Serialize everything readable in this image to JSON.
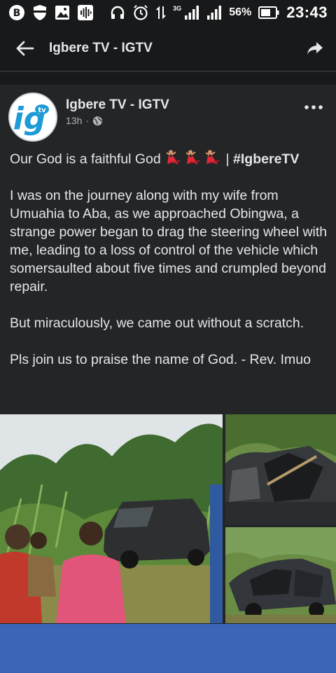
{
  "status_bar": {
    "network": "3G",
    "battery_percent": "56%",
    "time": "23:43"
  },
  "app_bar": {
    "title": "Igbere TV - IGTV"
  },
  "post": {
    "author": "Igbere TV - IGTV",
    "time_ago": "13h",
    "separator": "·",
    "avatar_text": "ig",
    "avatar_subtext": "tv",
    "caption_line": "Our God is a faithful God",
    "caption_sep": "|",
    "hashtag": "#IgbereTV",
    "paragraph_1": "I was on the journey along with my wife from Umuahia to Aba, as we approached Obingwa, a strange power began to drag the steering wheel with me, leading to a loss of control of the vehicle which somersaulted about five times and crumpled beyond repair.",
    "paragraph_2": "But miraculously, we came out without a scratch.",
    "paragraph_3": "Pls join us to praise the name of God. - Rev. Imuo"
  },
  "colors": {
    "background": "#242526",
    "app_bar": "#18191a",
    "bottom_bar": "#3b66b7",
    "avatar_blue": "#1e9ad6"
  }
}
